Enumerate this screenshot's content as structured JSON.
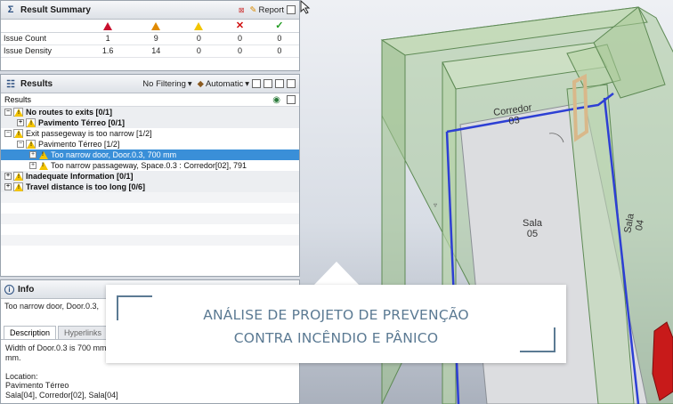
{
  "summary": {
    "title": "Result Summary",
    "report_label": "Report",
    "rows": [
      {
        "label": "Issue Count",
        "values": [
          "1",
          "9",
          "0",
          "0",
          "0"
        ]
      },
      {
        "label": "Issue Density",
        "values": [
          "1.6",
          "14",
          "0",
          "0",
          "0"
        ]
      }
    ],
    "column_icons": [
      "critical-warning-icon",
      "moderate-warning-icon",
      "low-warning-icon",
      "rejected-x-icon",
      "accepted-check-icon"
    ],
    "colors": {
      "critical": "#c8102e",
      "moderate": "#e08a00",
      "low": "#f2c500",
      "rejected": "#d01010",
      "accepted": "#1f9a1f"
    }
  },
  "results": {
    "title": "Results",
    "filter_label": "No Filtering",
    "auto_label": "Automatic",
    "column_header": "Results",
    "items": [
      {
        "label": "No routes to exits [0/1]",
        "indent": 0,
        "bold": true,
        "group": true,
        "expand": "−"
      },
      {
        "label": "Pavimento Térreo [0/1]",
        "indent": 1,
        "bold": true,
        "group": true,
        "expand": "+"
      },
      {
        "label": "Exit passegeway is too narrow [1/2]",
        "indent": 0,
        "bold": false,
        "group": false,
        "expand": "−"
      },
      {
        "label": "Pavimento Térreo [1/2]",
        "indent": 1,
        "bold": false,
        "group": false,
        "expand": "−"
      },
      {
        "label": "Too narrow door, Door.0.3, 700 mm",
        "indent": 2,
        "bold": false,
        "group": false,
        "expand": "+",
        "selected": true
      },
      {
        "label": "Too narrow passageway, Space.0.3 : Corredor[02], 791",
        "indent": 2,
        "bold": false,
        "group": false,
        "expand": "+"
      },
      {
        "label": "Inadequate Information [0/1]",
        "indent": 0,
        "bold": true,
        "group": true,
        "expand": "+"
      },
      {
        "label": "Travel distance is too long [0/6]",
        "indent": 0,
        "bold": true,
        "group": true,
        "expand": "+"
      }
    ]
  },
  "info": {
    "title": "Info",
    "text": "Too narrow door, Door.0.3,",
    "tabs": [
      "Description",
      "Hyperlinks"
    ],
    "description": "Width of Door.0.3 is 700 mm\nmm.\n\nLocation:\nPavimento Térreo\nSala[04], Corredor[02], Sala[04]"
  },
  "view3d": {
    "rooms": [
      {
        "name": "Corredor",
        "number": "03"
      },
      {
        "name": "Sala",
        "number": "05"
      },
      {
        "name": "Sala",
        "number": "04"
      }
    ]
  },
  "caption": {
    "line1": "ANÁLISE DE PROJETO DE PREVENÇÃO",
    "line2": "CONTRA INCÊNDIO E PÂNICO"
  }
}
